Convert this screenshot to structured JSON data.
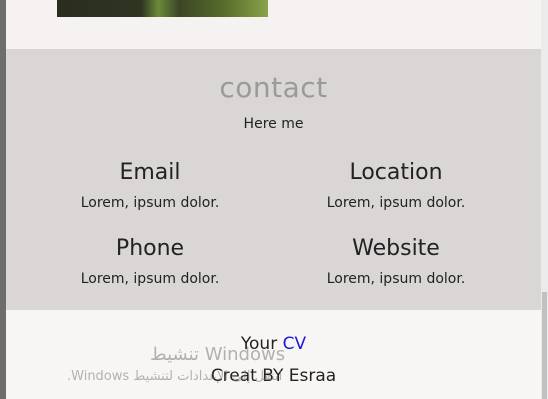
{
  "contact": {
    "title": "contact",
    "subtitle": "Here me",
    "items": [
      {
        "heading": "Email",
        "value": "Lorem, ipsum dolor."
      },
      {
        "heading": "Location",
        "value": "Lorem, ipsum dolor."
      },
      {
        "heading": "Phone",
        "value": "Lorem, ipsum dolor."
      },
      {
        "heading": "Website",
        "value": "Lorem, ipsum dolor."
      }
    ]
  },
  "footer": {
    "your": "Your",
    "cv": "CV",
    "credit": "Creat BY Esraa"
  },
  "watermark": {
    "line1": "Windows تنشيط",
    "line2": "انتقل إلى الإعدادات لتنشيط Windows."
  },
  "colors": {
    "contact_bg": "#d9d6d5",
    "cv_link": "#1a1ad8",
    "page_bg": "#f7f2f2"
  }
}
